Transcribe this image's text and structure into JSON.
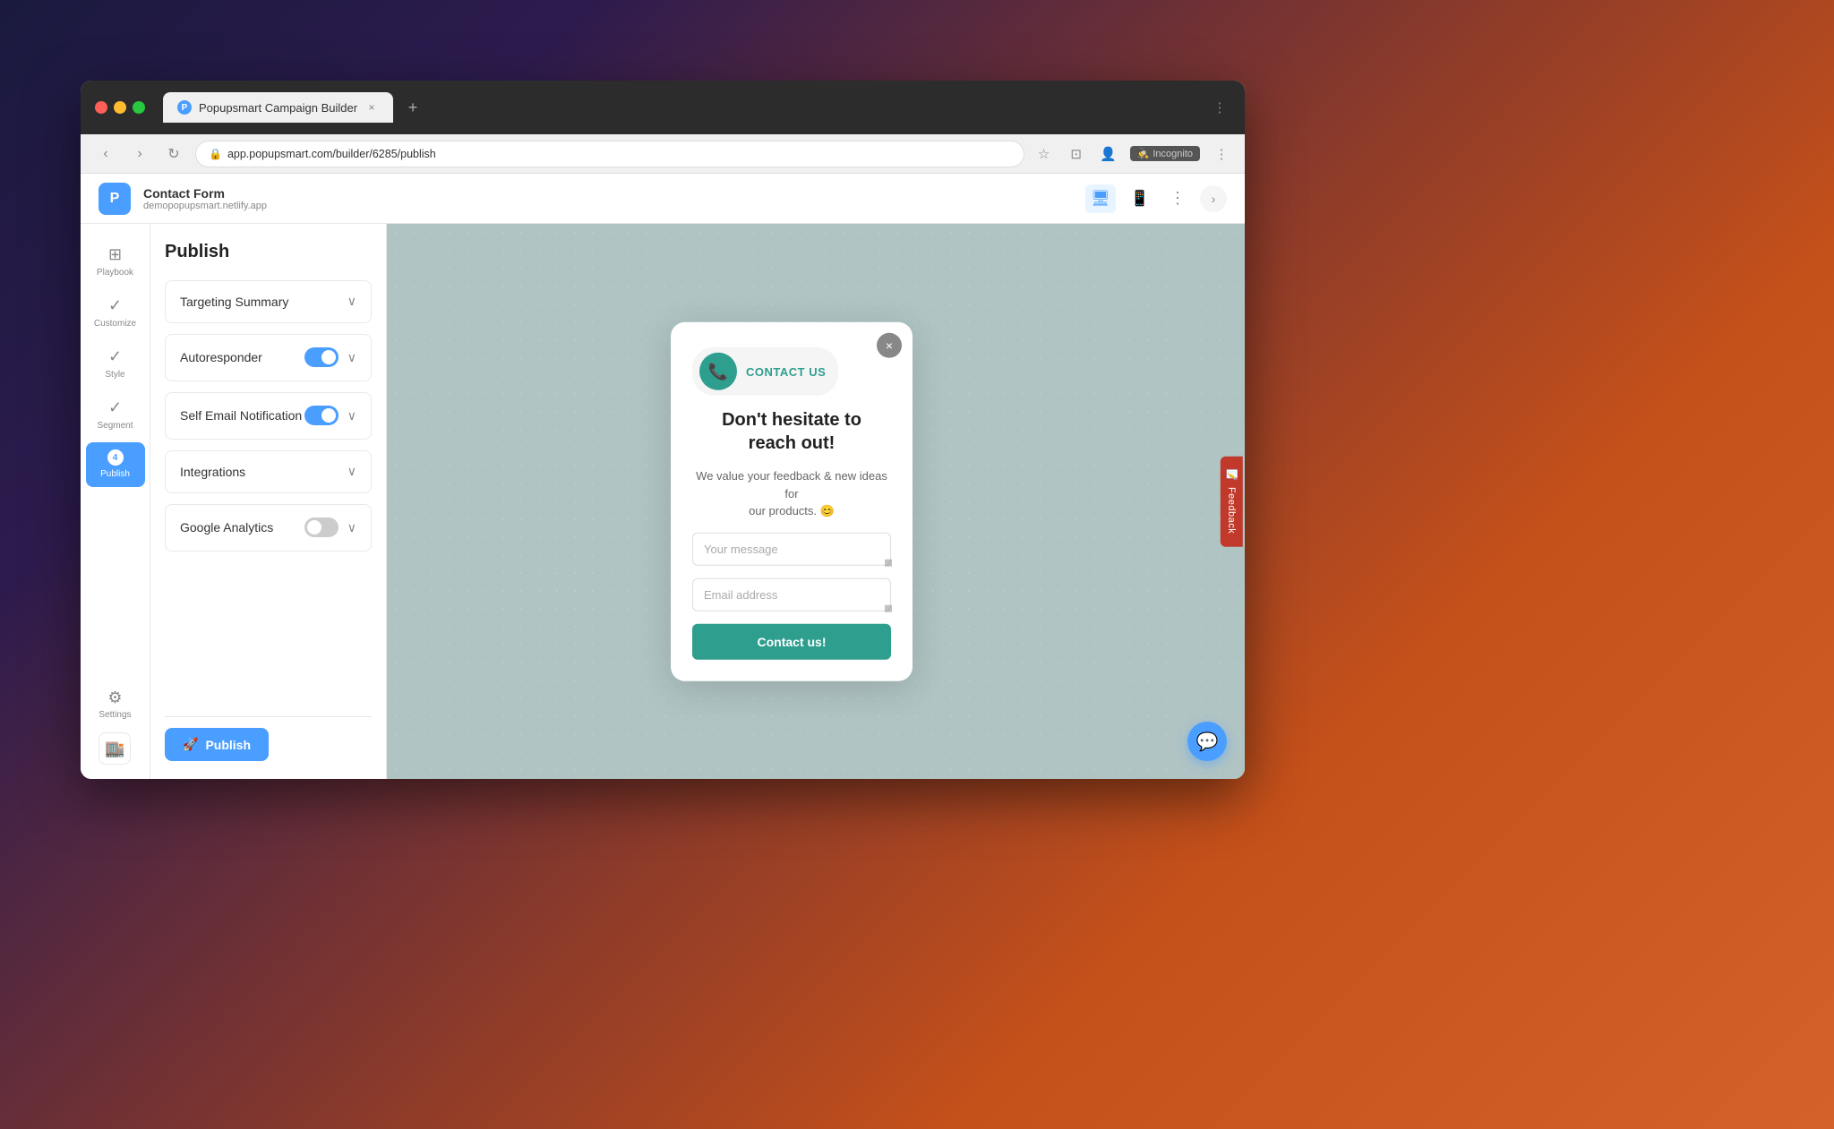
{
  "os": {
    "background_desc": "macOS gradient background orange/dark"
  },
  "browser": {
    "tab_title": "Popupsmart Campaign Builder",
    "tab_new_label": "+",
    "nav_back": "‹",
    "nav_forward": "›",
    "nav_refresh": "↻",
    "address_url": "app.popupsmart.com/builder/6285/publish",
    "browser_action_star": "☆",
    "browser_action_extension": "⧉",
    "incognito_label": "Incognito",
    "more_label": "⋮",
    "tab_close": "×"
  },
  "app_header": {
    "logo_letter": "P",
    "title": "Contact Form",
    "subtitle": "demopopupsmart.netlify.app",
    "device_desktop_title": "Desktop view",
    "device_mobile_title": "Mobile view",
    "more_label": "⋮",
    "expand_label": "›"
  },
  "sidebar": {
    "items": [
      {
        "id": "playbook",
        "icon": "⊞",
        "label": "Playbook",
        "badge": null,
        "active": false
      },
      {
        "id": "customize",
        "icon": "✓",
        "label": "Customize",
        "badge": null,
        "active": false
      },
      {
        "id": "style",
        "icon": "✓",
        "label": "Style",
        "badge": null,
        "active": false
      },
      {
        "id": "segment",
        "icon": "✓",
        "label": "Segment",
        "badge": null,
        "active": false
      },
      {
        "id": "publish",
        "icon": "4",
        "label": "Publish",
        "badge": "4",
        "active": true
      }
    ],
    "settings_icon": "⚙",
    "settings_label": "Settings",
    "store_icon": "🏬"
  },
  "publish_panel": {
    "title": "Publish",
    "sections": [
      {
        "id": "targeting-summary",
        "label": "Targeting Summary",
        "has_toggle": false,
        "toggle_on": false,
        "expanded": false
      },
      {
        "id": "autoresponder",
        "label": "Autoresponder",
        "has_toggle": true,
        "toggle_on": true,
        "expanded": false
      },
      {
        "id": "self-email-notification",
        "label": "Self Email Notification",
        "has_toggle": true,
        "toggle_on": true,
        "expanded": false
      },
      {
        "id": "integrations",
        "label": "Integrations",
        "has_toggle": false,
        "toggle_on": false,
        "expanded": false
      },
      {
        "id": "google-analytics",
        "label": "Google Analytics",
        "has_toggle": true,
        "toggle_on": false,
        "expanded": false
      }
    ],
    "publish_button_label": "Publish",
    "publish_button_icon": "🚀"
  },
  "popup_preview": {
    "close_icon": "×",
    "badge_icon": "📞",
    "contact_label": "CONTACT US",
    "headline": "Don't hesitate to\nreach out!",
    "subtext": "We value your feedback & new ideas for\nour products. 😊",
    "message_placeholder": "Your message",
    "email_placeholder": "Email address",
    "submit_button": "Contact us!",
    "popup_color": "#2e9e8e"
  },
  "feedback_tab": {
    "label": "Feedback"
  },
  "chat_bubble": {
    "icon": "💬"
  }
}
